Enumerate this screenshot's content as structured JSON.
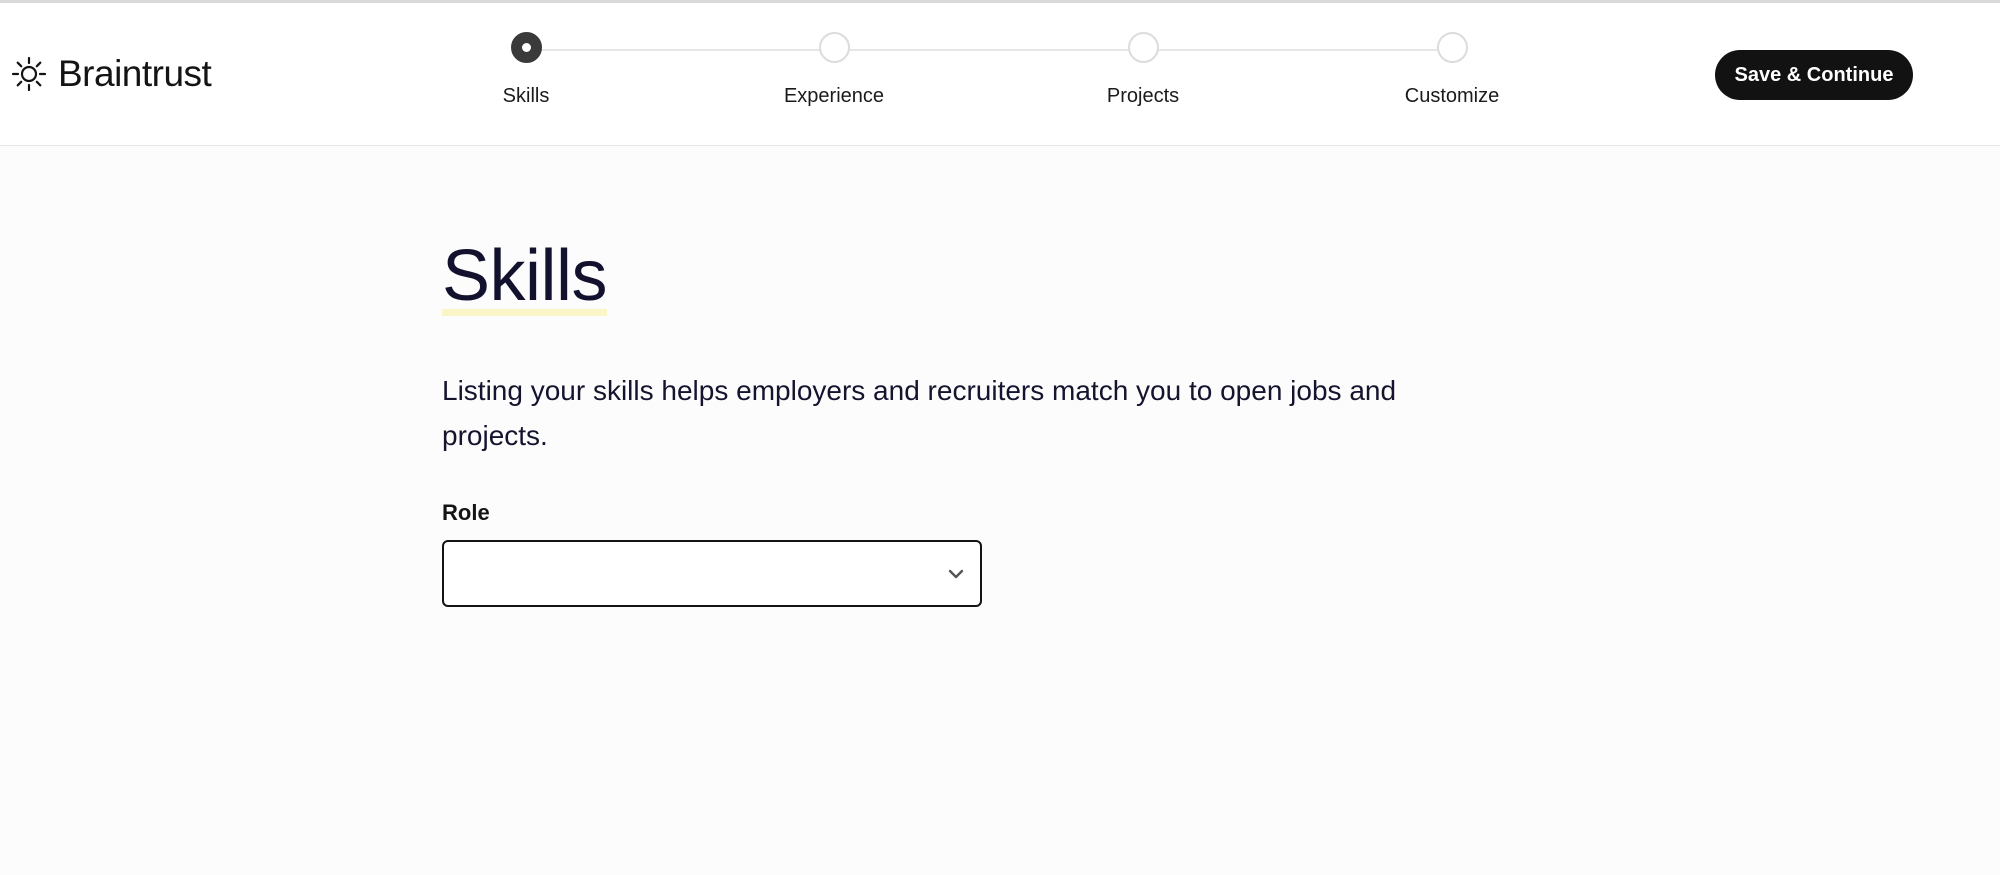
{
  "brand": {
    "name": "Braintrust",
    "icon": "sun-icon"
  },
  "stepper": {
    "steps": [
      {
        "label": "Skills",
        "active": true
      },
      {
        "label": "Experience",
        "active": false
      },
      {
        "label": "Projects",
        "active": false
      },
      {
        "label": "Customize",
        "active": false
      }
    ]
  },
  "header": {
    "save_label": "Save & Continue"
  },
  "main": {
    "title": "Skills",
    "description": "Listing your skills helps employers and recruiters match you to open jobs and projects.",
    "role": {
      "label": "Role",
      "value": "",
      "icon": "chevron-down-icon"
    }
  },
  "colors": {
    "primary_button": "#121212",
    "title_text": "#12122e",
    "title_highlight": "#fbf6c8",
    "active_step": "#3a3a3a"
  }
}
